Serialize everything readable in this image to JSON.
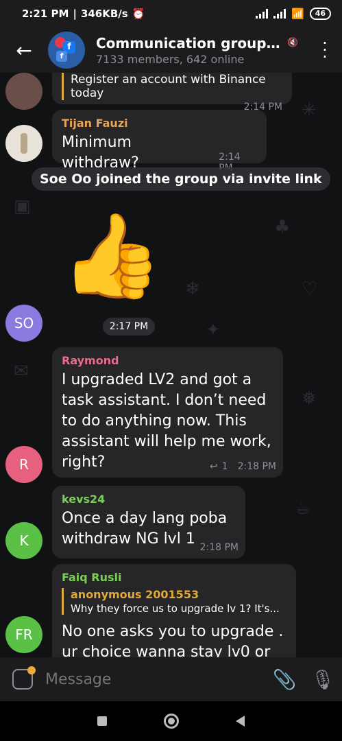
{
  "status_bar": {
    "time": "2:21 PM",
    "speed": "346KB/s",
    "battery": "46"
  },
  "header": {
    "title": "Communication group 0...",
    "members": "7133 members, 642 online"
  },
  "messages": {
    "m0": {
      "reply_text": "Register an account with Binance today",
      "time": "2:14 PM"
    },
    "m1": {
      "sender": "Tijan Fauzi",
      "sender_color": "#e8a35a",
      "text": "Minimum withdraw?",
      "time": "2:14 PM"
    },
    "system": {
      "text": "Soe Oo joined the group via invite link"
    },
    "sticker": {
      "emoji": "👍",
      "time": "2:17 PM",
      "avatar_initials": "SO",
      "avatar_color": "#8b7ae0"
    },
    "m2": {
      "sender": "Raymond",
      "sender_color": "#e86b8c",
      "text": "I upgraded LV2 and got a task assistant. I don’t need to do anything now. This assistant will help me work, right?",
      "reply_count": "1",
      "time": "2:18 PM",
      "avatar_initials": "R",
      "avatar_color": "#e8607f"
    },
    "m3": {
      "sender": "kevs24",
      "sender_color": "#7ccf55",
      "text": "Once a day lang poba withdraw NG lvl 1",
      "time": "2:18 PM",
      "avatar_initials": "K",
      "avatar_color": "#5bc046"
    },
    "m4": {
      "sender": "Faiq Rusli",
      "sender_color": "#7ccf55",
      "reply_name": "anonymous 2001553",
      "reply_text": "Why they force us to upgrade lv 1? It's...",
      "text": "No one asks you to upgrade . ur choice wanna stay lv0 or",
      "avatar_initials": "FR",
      "avatar_color": "#5bc046"
    }
  },
  "input": {
    "placeholder": "Message"
  },
  "colors": {
    "bubble": "#262628",
    "background": "#111214",
    "reply_accent": "#e2a93b"
  }
}
